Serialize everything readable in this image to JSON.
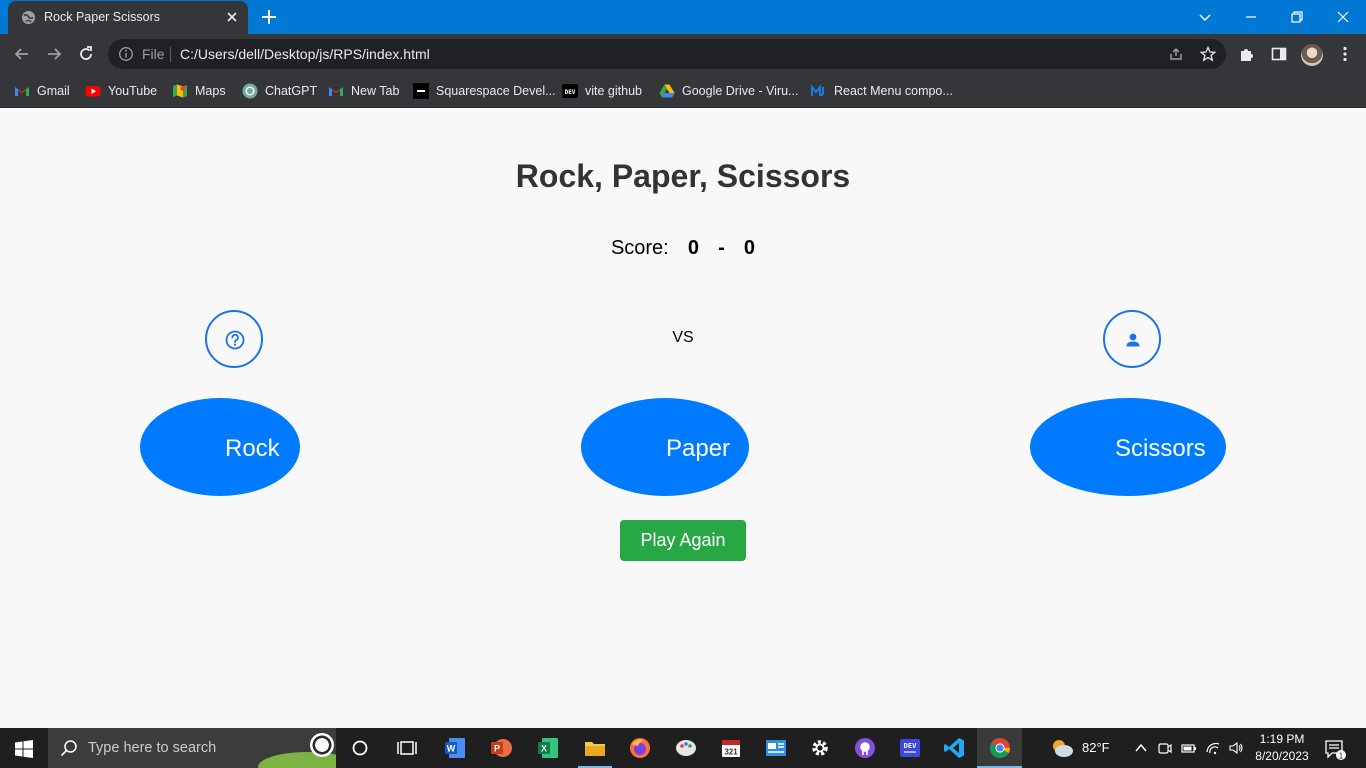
{
  "browser": {
    "tab": {
      "title": "Rock Paper Scissors",
      "close_icon": "close-icon"
    },
    "new_tab_icon": "plus-icon",
    "window_controls": [
      "chevron-down-icon",
      "minimize-icon",
      "restore-icon",
      "close-icon"
    ],
    "toolbar": {
      "scheme": "File",
      "url": "C:/Users/dell/Desktop/js/RPS/index.html"
    },
    "bookmarks": [
      {
        "label": "Gmail",
        "icon": "gmail-icon"
      },
      {
        "label": "YouTube",
        "icon": "youtube-icon"
      },
      {
        "label": "Maps",
        "icon": "maps-icon"
      },
      {
        "label": "ChatGPT",
        "icon": "chatgpt-icon"
      },
      {
        "label": "New Tab",
        "icon": "gmail-icon"
      },
      {
        "label": "Squarespace Devel...",
        "icon": "squarespace-icon"
      },
      {
        "label": "vite github",
        "icon": "dev-icon"
      },
      {
        "label": "Google Drive - Viru...",
        "icon": "google-drive-icon"
      },
      {
        "label": "React Menu compo...",
        "icon": "react-menu-icon"
      }
    ]
  },
  "game": {
    "title": "Rock, Paper, Scissors",
    "score_label": "Score:",
    "player_score": "0",
    "score_separator": "-",
    "computer_score": "0",
    "vs_label": "VS",
    "player_icon": "question-icon",
    "computer_icon": "person-icon",
    "choices": [
      {
        "label": "Rock"
      },
      {
        "label": "Paper"
      },
      {
        "label": "Scissors"
      }
    ],
    "play_again_label": "Play Again",
    "colors": {
      "choice": "#007bff",
      "play_again": "#28a745",
      "icon_border": "#1a73e8"
    }
  },
  "taskbar": {
    "search_placeholder": "Type here to search",
    "weather": "82°F",
    "time": "1:19 PM",
    "date": "8/20/2023",
    "notification_count": "1",
    "apps": [
      "cortana-icon",
      "task-view-icon",
      "word-icon",
      "powerpoint-icon",
      "excel-icon",
      "file-explorer-icon",
      "firefox-icon",
      "paint-icon",
      "calendar-icon",
      "news-icon",
      "settings-icon",
      "github-icon",
      "dev-icon",
      "vscode-icon",
      "chrome-icon"
    ]
  }
}
